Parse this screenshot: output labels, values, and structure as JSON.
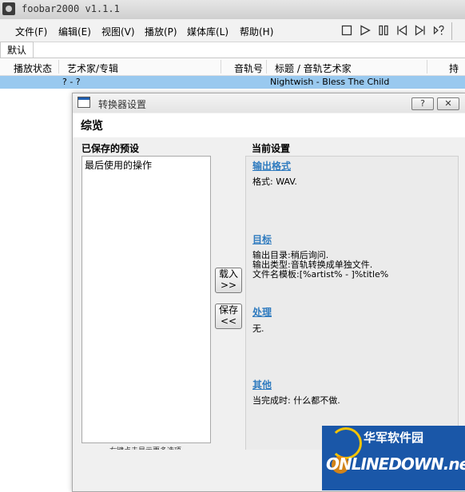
{
  "window": {
    "title": "foobar2000 v1.1.1"
  },
  "menu": [
    "文件(F)",
    "编辑(E)",
    "视图(V)",
    "播放(P)",
    "媒体库(L)",
    "帮助(H)"
  ],
  "toolbar": [
    "stop-icon",
    "play-icon",
    "pause-icon",
    "prev-icon",
    "next-icon",
    "random-icon"
  ],
  "tabs": [
    {
      "label": "默认"
    }
  ],
  "playlist": {
    "columns": [
      "播放状态",
      "艺术家/专辑",
      "音轨号",
      "标题 / 音轨艺术家",
      "持续"
    ],
    "rows": [
      {
        "artist": "? - ?",
        "title": "Nightwish - Bless The Child"
      }
    ]
  },
  "dialog": {
    "title": "转换器设置",
    "help_button": "?",
    "close_button": "✕",
    "heading": "综览",
    "saved_presets_label": "已保存的预设",
    "presets": [
      "最后使用的操作"
    ],
    "hint": "右键点击显示更多选项.",
    "load_button": {
      "line1": "载入",
      "line2": ">>"
    },
    "save_button": {
      "line1": "保存",
      "line2": "<<"
    },
    "current_label": "当前设置",
    "sections": [
      {
        "title": "输出格式",
        "text": "格式: WAV."
      },
      {
        "title": "目标",
        "text": "输出目录:稍后询问.\n输出类型:音轨转换成单独文件.\n文件名模板:[%artist% - ]%title%"
      },
      {
        "title": "处理",
        "text": "无."
      },
      {
        "title": "其他",
        "text": "当完成时: 什么都不做."
      }
    ]
  },
  "watermark": {
    "cn": "华军软件园",
    "en": "ONLINEDOWN.net"
  },
  "colors": {
    "selection": "#99c9ef",
    "link": "#2f7bbf",
    "watermark_bg": "#1a57a8"
  }
}
